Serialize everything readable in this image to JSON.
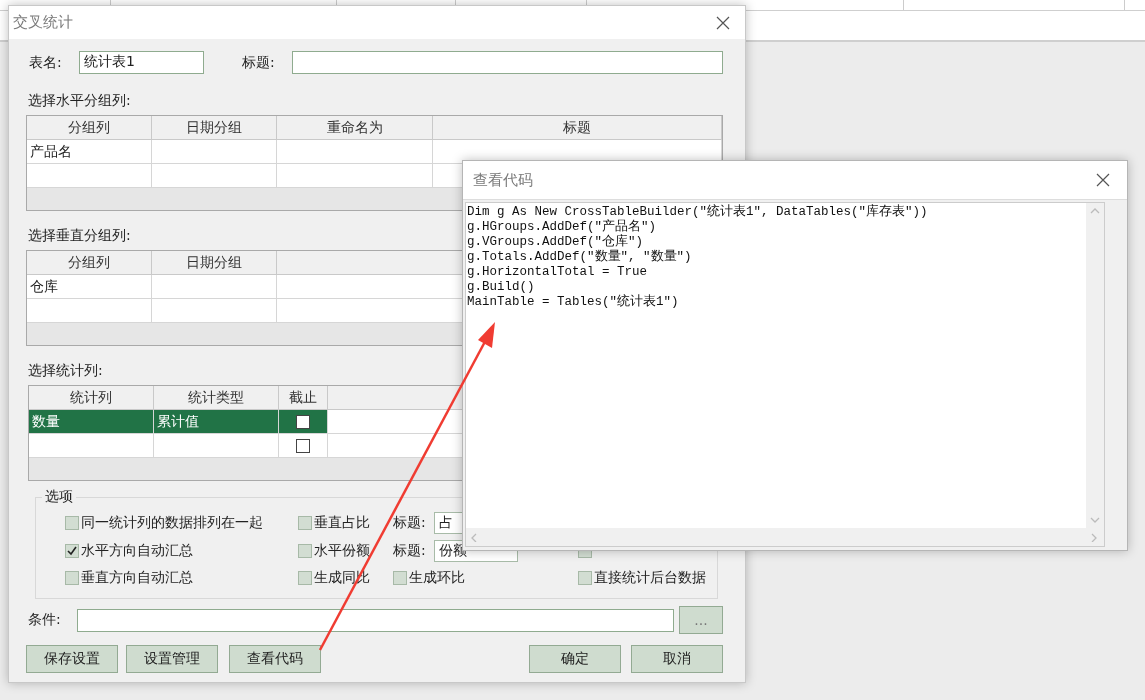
{
  "dialog": {
    "title": "交叉统计",
    "table_name": {
      "label": "表名:",
      "value": "统计表1"
    },
    "caption": {
      "label": "标题:"
    },
    "horizontal_groups": {
      "label": "选择水平分组列:",
      "columns": [
        "分组列",
        "日期分组",
        "重命名为",
        "标题"
      ],
      "rows": [
        {
          "values": [
            "产品名"
          ]
        }
      ]
    },
    "vertical_groups": {
      "label": "选择垂直分组列:",
      "columns": [
        "分组列",
        "日期分组"
      ],
      "rows": [
        {
          "values": [
            "仓库"
          ]
        }
      ]
    },
    "totals": {
      "label": "选择统计列:",
      "columns": [
        "统计列",
        "统计类型",
        "截止"
      ],
      "rows": [
        {
          "values": [
            "数量",
            "累计值"
          ],
          "cutoff": false,
          "selected": true
        },
        {
          "cutoff": false,
          "selected": false
        }
      ]
    },
    "options": {
      "title": "选项",
      "rows": [
        {
          "items": [
            {
              "kind": "checkbox",
              "label": "同一统计列的数据排列在一起",
              "checked": false
            },
            {
              "kind": "checkbox",
              "label": "垂直占比",
              "checked": false
            },
            {
              "kind": "field",
              "label": "标题:",
              "value": "占"
            }
          ]
        },
        {
          "items": [
            {
              "kind": "checkbox",
              "label": "水平方向自动汇总",
              "checked": true
            },
            {
              "kind": "checkbox",
              "label": "水平份额",
              "checked": false
            },
            {
              "kind": "field",
              "label": "标题:",
              "value": "份额"
            },
            {
              "kind": "checkbox",
              "checked": false
            }
          ]
        },
        {
          "items": [
            {
              "kind": "checkbox",
              "label": "垂直方向自动汇总",
              "checked": false
            },
            {
              "kind": "checkbox",
              "label": "生成同比",
              "checked": false
            },
            {
              "kind": "checkbox",
              "label": "生成环比",
              "checked": false
            },
            {
              "kind": "checkbox",
              "label": "直接统计后台数据",
              "checked": false
            }
          ]
        }
      ]
    },
    "condition": {
      "label": "条件:",
      "button": "..."
    },
    "left_buttons": [
      "保存设置",
      "设置管理",
      "查看代码"
    ],
    "right_buttons": [
      "确定",
      "取消"
    ]
  },
  "code_window": {
    "title": "查看代码",
    "lines": [
      "Dim g As New CrossTableBuilder(\"统计表1\", DataTables(\"库存表\"))",
      "g.HGroups.AddDef(\"产品名\")",
      "g.VGroups.AddDef(\"仓库\")",
      "g.Totals.AddDef(\"数量\", \"数量\")",
      "g.HorizontalTotal = True",
      "g.Build()",
      "MainTable = Tables(\"统计表1\")"
    ]
  }
}
